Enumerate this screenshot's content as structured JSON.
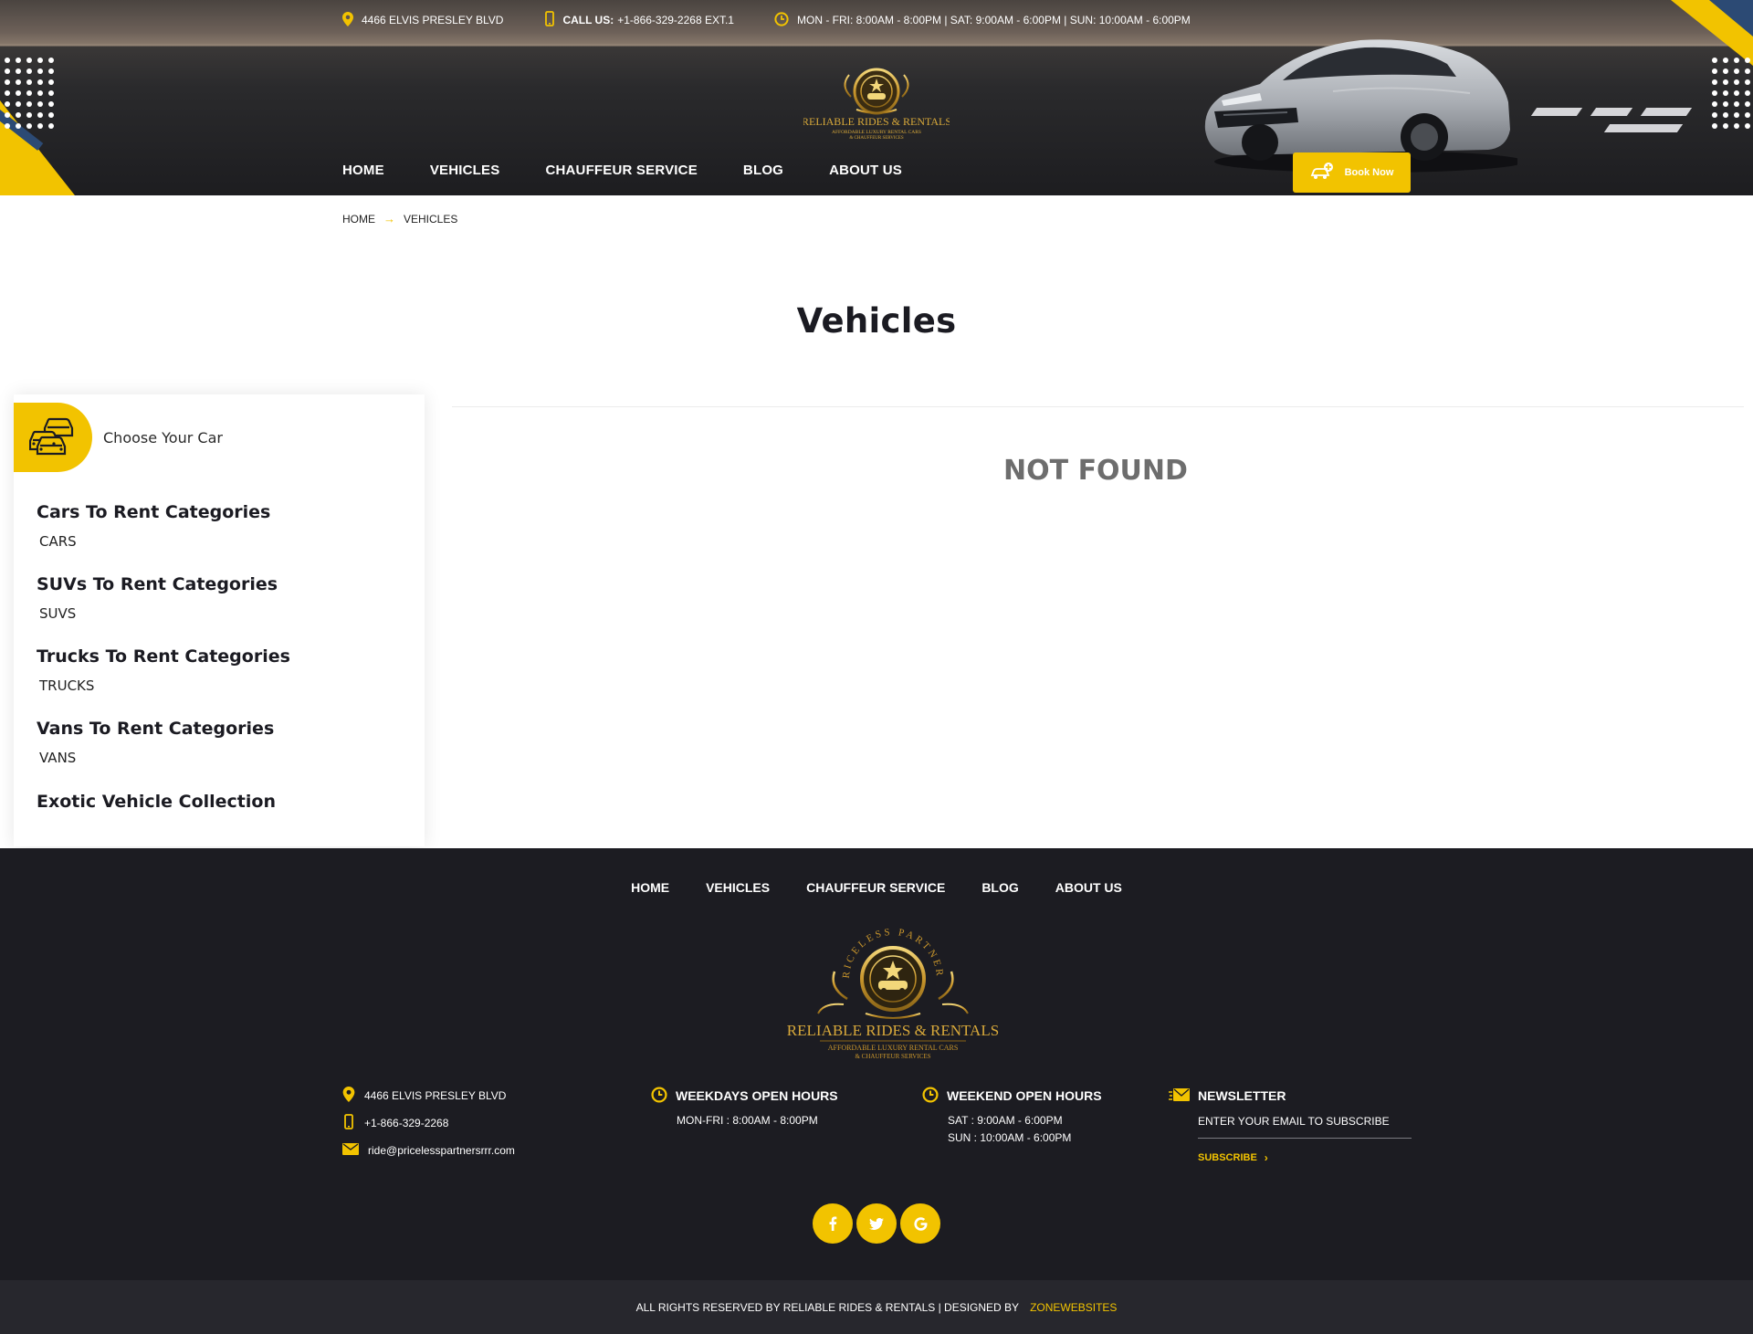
{
  "colors": {
    "accent": "#f2c300",
    "dark": "#1c1c22",
    "bottom_bar": "#27272d",
    "blue": "#2c4a74"
  },
  "topbar": {
    "address": "4466 ELVIS PRESLEY BLVD",
    "call_label": "CALL US:",
    "call_value": "+1-866-329-2268 EXT.1",
    "hours": "MON - FRI: 8:00AM - 8:00PM | SAT: 9:00AM - 6:00PM | SUN: 10:00AM - 6:00PM"
  },
  "logo": {
    "arc_text": "PRICELESS PARTNERS",
    "name": "RELIABLE RIDES & RENTALS",
    "tagline1": "AFFORDABLE LUXURY RENTAL CARS",
    "tagline2": "& CHAUFFEUR SERVICES"
  },
  "nav": [
    "HOME",
    "VEHICLES",
    "CHAUFFEUR SERVICE",
    "BLOG",
    "ABOUT US"
  ],
  "book_now": "Book Now",
  "breadcrumb": {
    "home": "HOME",
    "arrow": "→",
    "current": "VEHICLES"
  },
  "page_title": "Vehicles",
  "not_found": "NOT FOUND",
  "sidebar": {
    "header": "Choose Your Car",
    "categories": [
      {
        "title": "Cars To Rent Categories",
        "sub": "CARS"
      },
      {
        "title": "SUVs To Rent Categories",
        "sub": "SUVS"
      },
      {
        "title": "Trucks To Rent Categories",
        "sub": "TRUCKS"
      },
      {
        "title": "Vans To Rent Categories",
        "sub": "VANS"
      },
      {
        "title": "Exotic Vehicle Collection",
        "sub": ""
      }
    ]
  },
  "footer": {
    "nav": [
      "HOME",
      "VEHICLES",
      "CHAUFFEUR SERVICE",
      "BLOG",
      "ABOUT US"
    ],
    "address": "4466 ELVIS PRESLEY BLVD",
    "phone": "+1-866-329-2268",
    "email": "ride@pricelesspartnersrrr.com",
    "weekdays": {
      "title": "WEEKDAYS OPEN HOURS",
      "line1": "MON-FRI : 8:00AM - 8:00PM"
    },
    "weekend": {
      "title": "WEEKEND OPEN HOURS",
      "line1": "SAT : 9:00AM - 6:00PM",
      "line2": "SUN : 10:00AM - 6:00PM"
    },
    "newsletter": {
      "title": "NEWSLETTER",
      "placeholder": "ENTER YOUR EMAIL TO SUBSCRIBE",
      "button": "SUBSCRIBE"
    },
    "social": [
      "f",
      "t",
      "G"
    ],
    "copyright": "ALL RIGHTS RESERVED BY RELIABLE RIDES & RENTALS | DESIGNED BY",
    "designer": "ZONEWEBSITES"
  }
}
